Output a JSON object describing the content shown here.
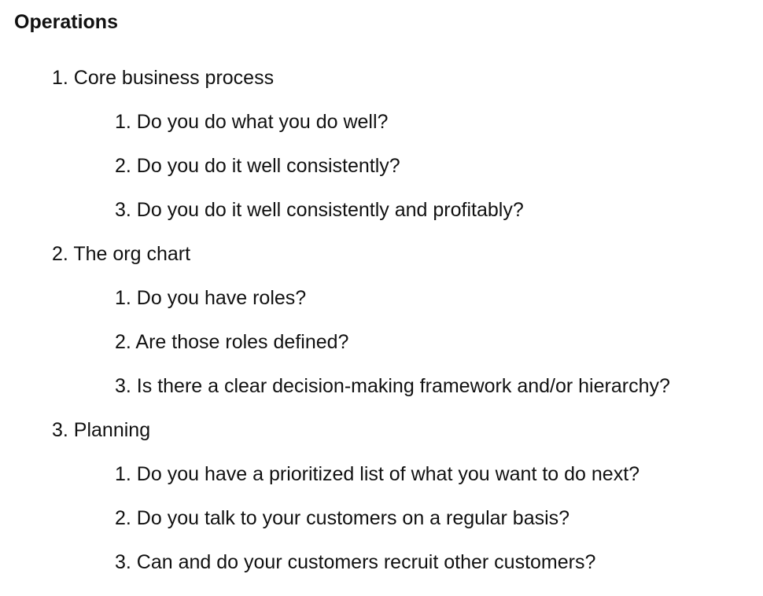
{
  "document": {
    "heading": "Operations",
    "sections": [
      {
        "number": "1.",
        "title": "Core business process",
        "items": [
          {
            "number": "1.",
            "text": "Do you do what you do well?"
          },
          {
            "number": "2.",
            "text": "Do you do it well consistently?"
          },
          {
            "number": "3.",
            "text": "Do you do it well consistently and profitably?"
          }
        ]
      },
      {
        "number": "2.",
        "title": "The org chart",
        "items": [
          {
            "number": "1.",
            "text": "Do you have roles?"
          },
          {
            "number": "2.",
            "text": "Are those roles defined?"
          },
          {
            "number": "3.",
            "text": "Is there a clear decision-making framework and/or hierarchy?"
          }
        ]
      },
      {
        "number": "3.",
        "title": "Planning",
        "items": [
          {
            "number": "1.",
            "text": "Do you have a prioritized list of what you want to do next?"
          },
          {
            "number": "2.",
            "text": "Do you talk to your customers on a regular basis?"
          },
          {
            "number": "3.",
            "text": "Can and do your customers recruit other customers?"
          }
        ]
      }
    ]
  }
}
